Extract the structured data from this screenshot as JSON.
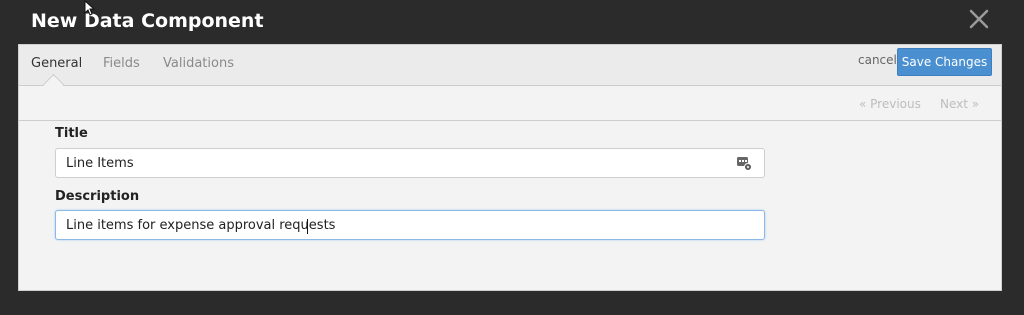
{
  "dialog": {
    "title": "New Data Component"
  },
  "tabs": [
    {
      "label": "General",
      "active": true
    },
    {
      "label": "Fields",
      "active": false
    },
    {
      "label": "Validations",
      "active": false
    }
  ],
  "actions": {
    "cancel_label": "cancel",
    "save_label": "Save Changes"
  },
  "pager": {
    "previous_label": "« Previous",
    "next_label": "Next »"
  },
  "form": {
    "title_label": "Title",
    "title_value": "Line Items",
    "description_label": "Description",
    "description_value": "Line items for expense approval requests"
  },
  "colors": {
    "accent": "#4a8fd0",
    "background": "#2b2b2b",
    "panel": "#f3f3f3"
  }
}
